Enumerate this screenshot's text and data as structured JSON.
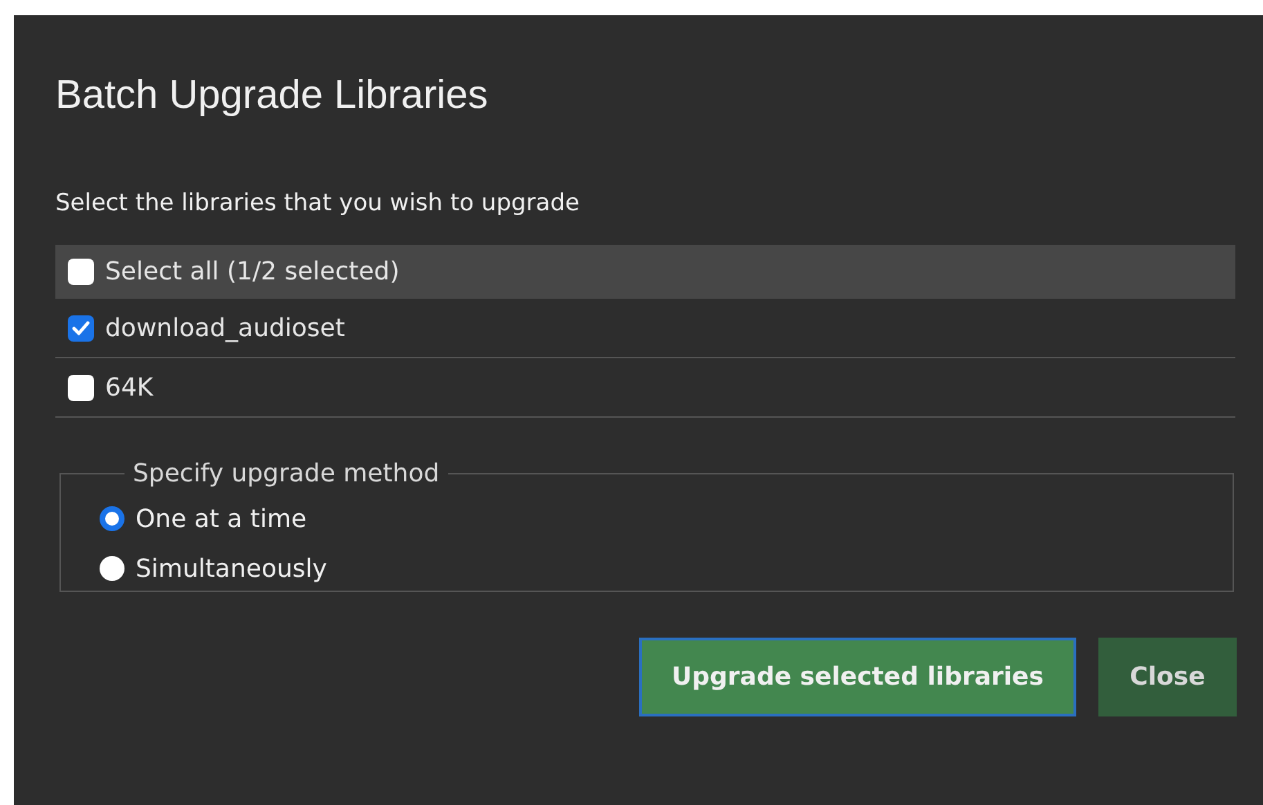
{
  "dialog": {
    "title": "Batch Upgrade Libraries"
  },
  "instruction": "Select the libraries that you wish to upgrade",
  "libraries": [
    {
      "kind": "select_all",
      "label": "Select all (1/2 selected)",
      "checked": false
    },
    {
      "kind": "item",
      "label": "download_audioset",
      "checked": true
    },
    {
      "kind": "item",
      "label": "64K",
      "checked": false
    }
  ],
  "method": {
    "legend": "Specify upgrade method",
    "options": [
      {
        "label": "One at a time",
        "selected": true
      },
      {
        "label": "Simultaneously",
        "selected": false
      }
    ]
  },
  "buttons": [
    {
      "label": "Upgrade selected libraries",
      "kind": "primary",
      "focused": true
    },
    {
      "label": "Close",
      "kind": "secondary",
      "focused": false
    }
  ]
}
